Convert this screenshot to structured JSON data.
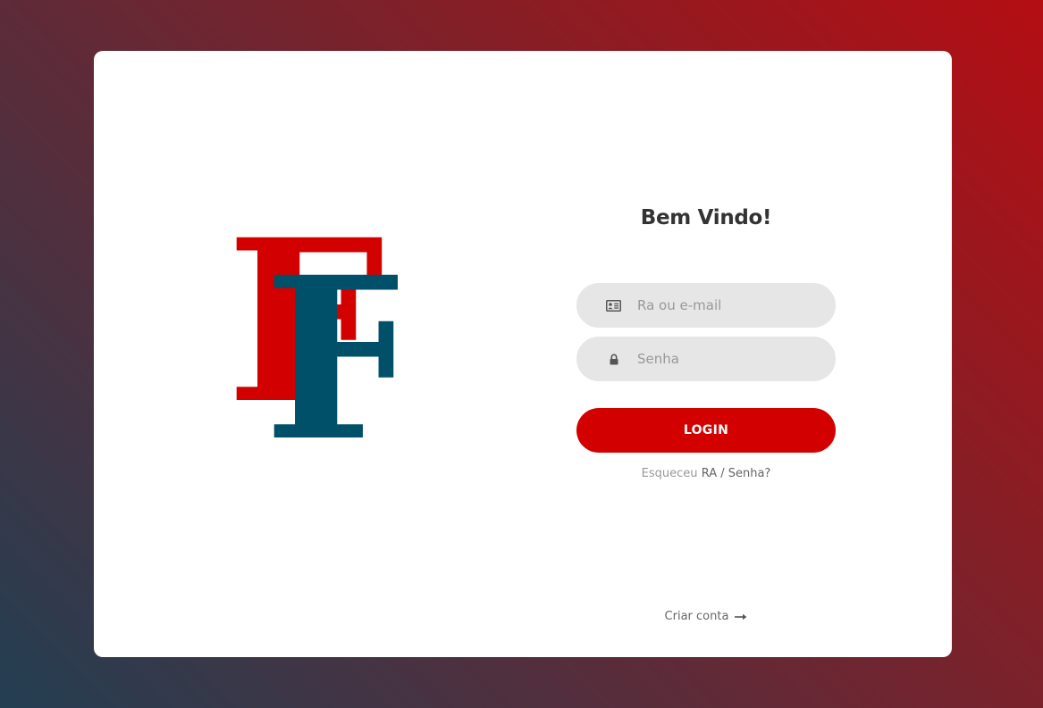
{
  "brand": {
    "logo_letters": [
      "F",
      "F"
    ],
    "colors": {
      "logo_red": "#d30000",
      "logo_teal": "#00506a",
      "accent": "#d30000"
    }
  },
  "login": {
    "title": "Bem Vindo!",
    "ra_field": {
      "icon": "id-card-icon",
      "placeholder": "Ra ou e-mail",
      "value": ""
    },
    "password_field": {
      "icon": "lock-icon",
      "placeholder": "Senha",
      "value": ""
    },
    "login_button": "LOGIN",
    "forgot": {
      "prefix": "Esqueceu",
      "link": "RA / Senha?"
    },
    "create_account": {
      "label": "Criar conta",
      "icon": "arrow-right-icon"
    }
  }
}
